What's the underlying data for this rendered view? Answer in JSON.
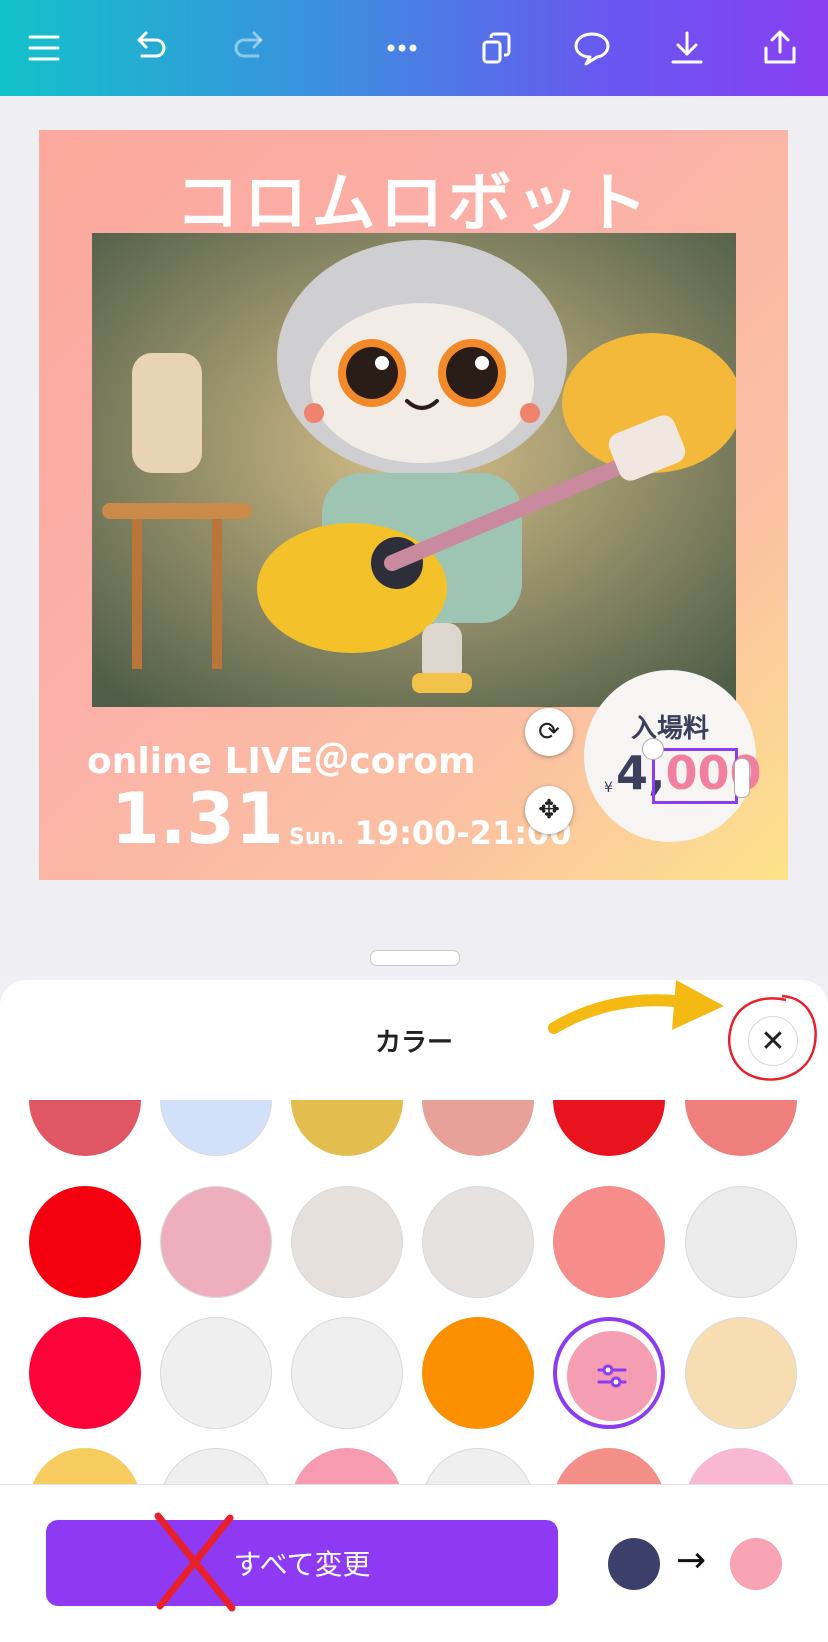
{
  "toolbar": {
    "menu_icon": "hamburger-menu-icon",
    "undo_icon": "undo-icon",
    "redo_icon": "redo-icon",
    "more_icon": "more-horizontal-icon",
    "pages_icon": "duplicate-pages-icon",
    "comment_icon": "comment-icon",
    "download_icon": "download-icon",
    "share_icon": "share-icon"
  },
  "poster": {
    "title": "コロムロボット",
    "live_text": "online LIVE＠corom",
    "date": "1.31",
    "day": "Sun.",
    "time": "19:00-21:00",
    "price_label": "入場料",
    "currency": "¥",
    "price_dark": "4,",
    "price_pink": "000"
  },
  "sheet": {
    "title": "カラー",
    "close_icon": "close-icon",
    "swatches": [
      [
        "#e05763",
        "#d3e0f9",
        "#e4bd4f",
        "#e8a199",
        "#e8131f",
        "#ee7f7c"
      ],
      [
        "#f4000f",
        "#edafbe",
        "#e6e0dd",
        "#e6e2df",
        "#f68d8a",
        "#ebebeb"
      ],
      [
        "#fc0339",
        "#efefef",
        "#efefef",
        "#fa8f00",
        "#f49db3",
        "#f8dcb2"
      ],
      [
        "#f6cc5e",
        "#efefef",
        "#f79cb0",
        "#efefef",
        "#f48e88",
        "#f8b8d2"
      ]
    ],
    "custom_color_icon": "sliders-icon",
    "change_all_label": "すべて変更",
    "from_color": "#3c3f6a",
    "to_color": "#f7a3b3"
  }
}
